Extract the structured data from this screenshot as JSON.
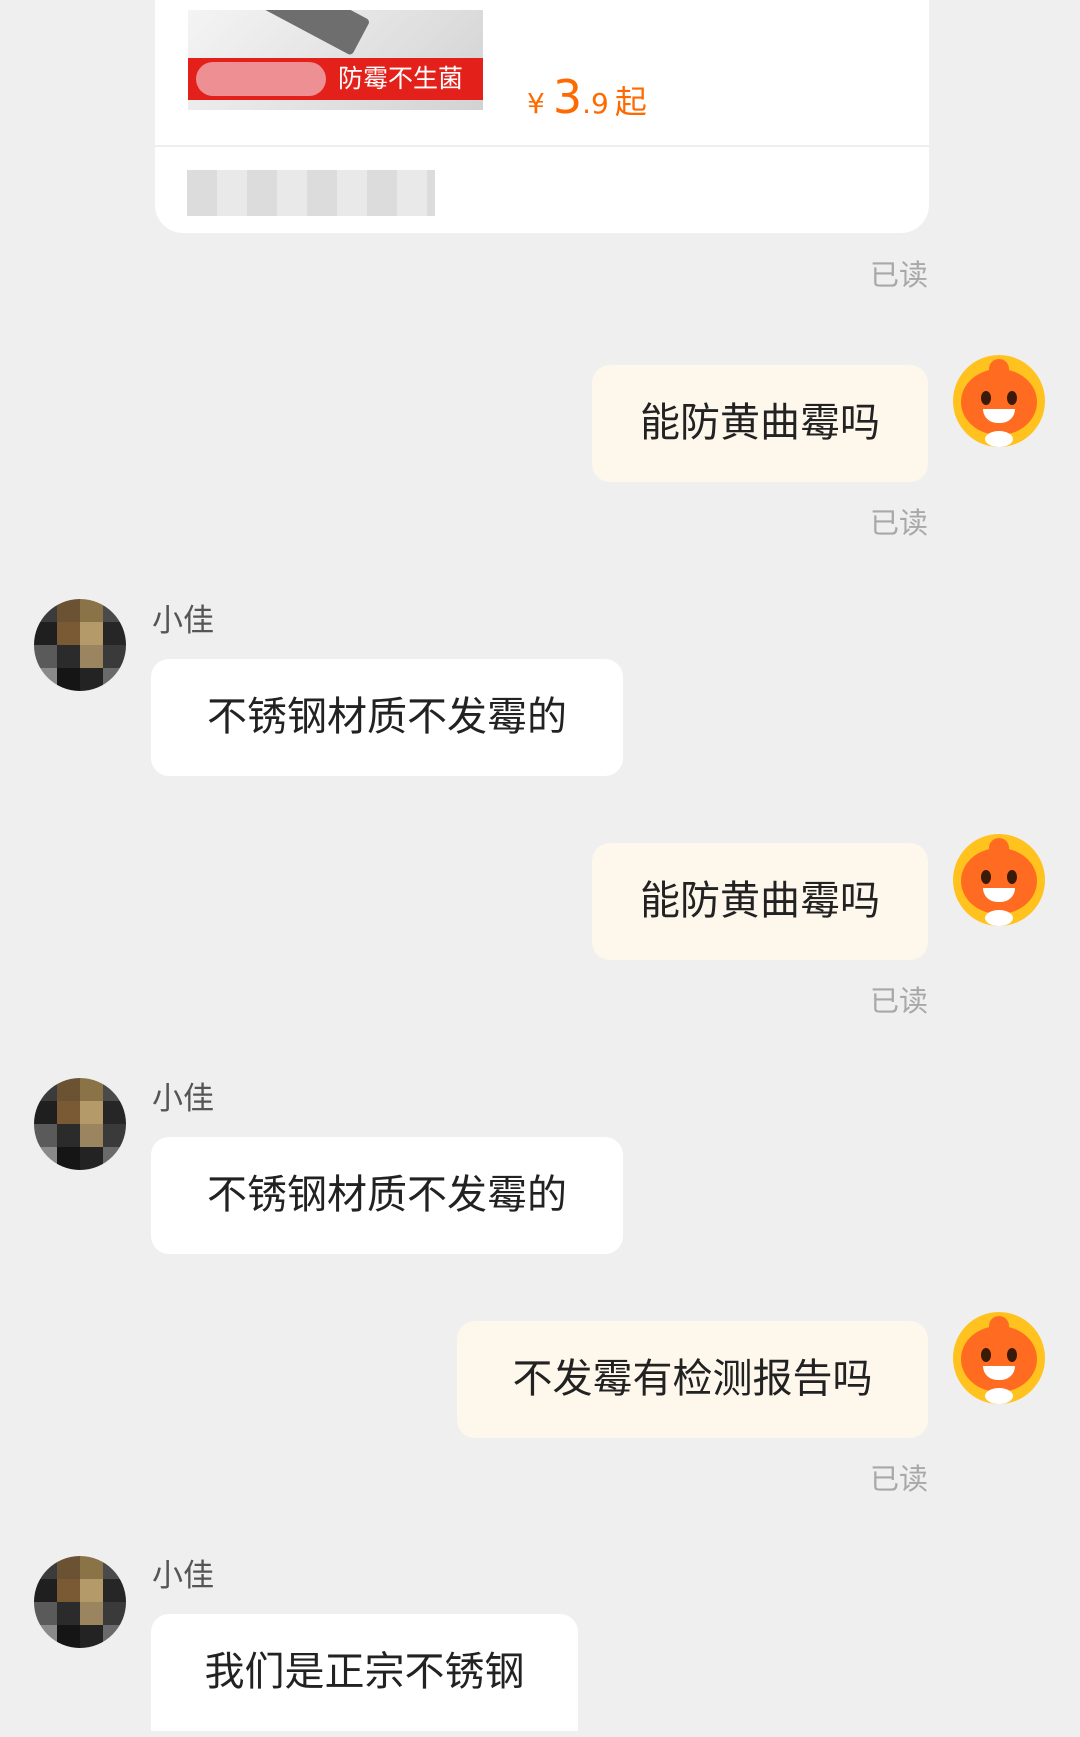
{
  "product_card": {
    "tag_text": "防霉不生菌",
    "price_symbol": "¥",
    "price_integer": "3",
    "price_decimal": ".9",
    "price_suffix": "起"
  },
  "messages": [
    {
      "side": "self",
      "text": "能防黄曲霉吗",
      "status": "已读"
    },
    {
      "side": "other",
      "sender": "小佳",
      "text": "不锈钢材质不发霉的"
    },
    {
      "side": "self",
      "text": "能防黄曲霉吗",
      "status": "已读"
    },
    {
      "side": "other",
      "sender": "小佳",
      "text": "不锈钢材质不发霉的"
    },
    {
      "side": "self",
      "text": "不发霉有检测报告吗",
      "status": "已读"
    },
    {
      "side": "other",
      "sender": "小佳",
      "text": "我们是正宗不锈钢"
    }
  ],
  "card_status": "已读",
  "colors": {
    "background": "#efefef",
    "self_bubble": "#fdf7ec",
    "other_bubble": "#ffffff",
    "price": "#ff6a00",
    "read_text": "#a8a8a8",
    "tag_red": "#e3211a"
  },
  "icons": {
    "self_avatar": "orange-mascot-icon",
    "other_avatar": "pixelated-avatar-icon"
  }
}
